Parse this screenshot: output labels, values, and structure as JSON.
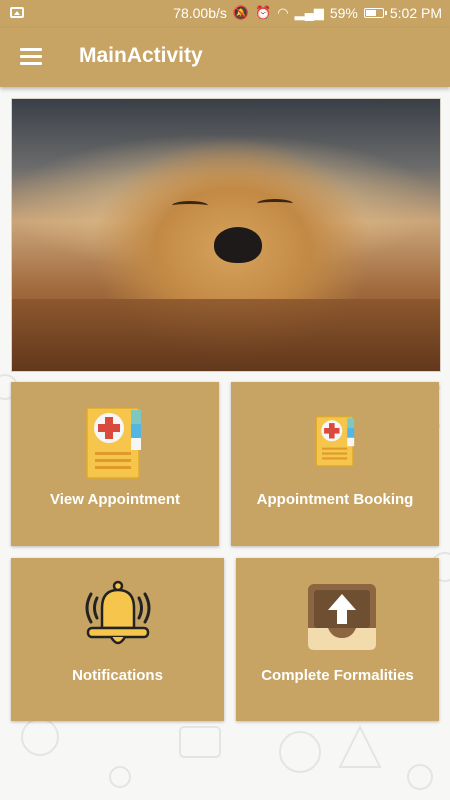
{
  "status_bar": {
    "speed": "78.00b/s",
    "battery": "59%",
    "time": "5:02 PM"
  },
  "app_bar": {
    "title": "MainActivity"
  },
  "hero": {
    "image": "sleeping-golden-retriever-photo"
  },
  "cards": [
    {
      "label": "View Appointment",
      "icon": "medical-folder-icon"
    },
    {
      "label": "Appointment Booking",
      "icon": "medical-folder-icon"
    },
    {
      "label": "Notifications",
      "icon": "bell-icon"
    },
    {
      "label": "Complete Formalities",
      "icon": "upload-tray-icon"
    }
  ],
  "colors": {
    "primary": "#c7a463",
    "background": "#f7f7f5"
  }
}
